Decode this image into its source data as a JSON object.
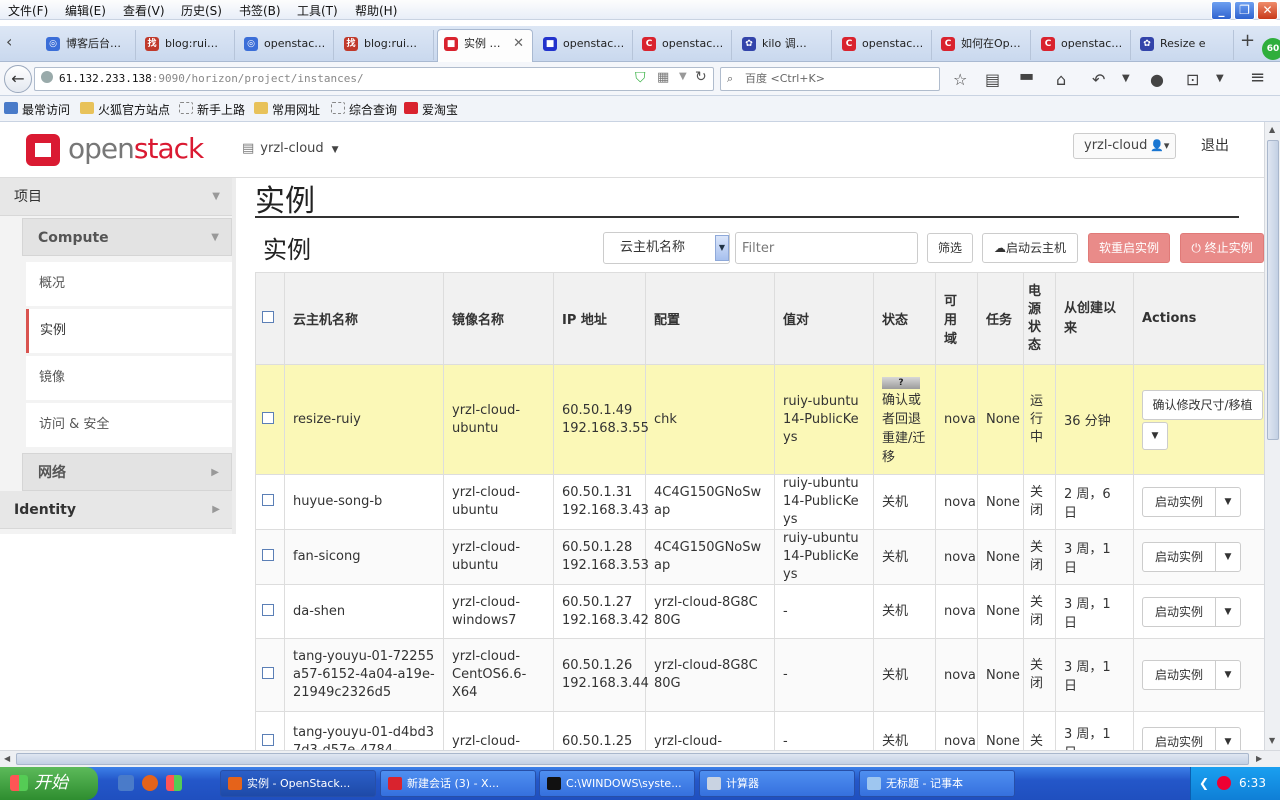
{
  "browser": {
    "menu": [
      "文件(F)",
      "编辑(E)",
      "查看(V)",
      "历史(S)",
      "书签(B)",
      "工具(T)",
      "帮助(H)"
    ],
    "tabs": [
      {
        "label": "博客后台…",
        "color": "#3b6ed8",
        "glyph": "◎"
      },
      {
        "label": "blog:rui…",
        "color": "#c0392b",
        "glyph": "找"
      },
      {
        "label": "openstac…",
        "color": "#3b6ed8",
        "glyph": "◎"
      },
      {
        "label": "blog:rui…",
        "color": "#c0392b",
        "glyph": "找"
      },
      {
        "label": "实例 …",
        "color": "#d9232e",
        "glyph": "■"
      },
      {
        "label": "openstac…",
        "color": "#2233cc",
        "glyph": "■"
      },
      {
        "label": "openstac…",
        "color": "#d9232e",
        "glyph": "C"
      },
      {
        "label": "kilo 调…",
        "color": "#3344aa",
        "glyph": "✿"
      },
      {
        "label": "openstac…",
        "color": "#d9232e",
        "glyph": "C"
      },
      {
        "label": "如何在Op…",
        "color": "#d9232e",
        "glyph": "C"
      },
      {
        "label": "openstac…",
        "color": "#d9232e",
        "glyph": "C"
      },
      {
        "label": "Resize e",
        "color": "#3344aa",
        "glyph": "✿"
      }
    ],
    "url_host": "61.132.233.138",
    "url_rest": ":9090/horizon/project/instances/",
    "search_placeholder": "百度 <Ctrl+K>",
    "bookmarks": [
      "最常访问",
      "火狐官方站点",
      "新手上路",
      "常用网址",
      "综合查询",
      "爱淘宝"
    ],
    "badge": "60"
  },
  "header": {
    "logo_open": "open",
    "logo_stack": "stack",
    "project": "yrzl-cloud",
    "user": "yrzl-cloud",
    "logout": "退出"
  },
  "sidebar": {
    "project": "项目",
    "compute": "Compute",
    "items": [
      "概况",
      "实例",
      "镜像",
      "访问 & 安全"
    ],
    "network": "网络",
    "identity": "Identity"
  },
  "main": {
    "title": "实例",
    "panel_title": "实例",
    "filter_select": "云主机名称",
    "filter_placeholder": "Filter",
    "filter_button": "筛选",
    "launch_button": "启动云主机",
    "soft_reboot_button": "软重启实例",
    "terminate_button": "终止实例"
  },
  "table": {
    "headers": [
      "云主机名称",
      "镜像名称",
      "IP 地址",
      "配置",
      "值对",
      "状态",
      "可用域",
      "任务",
      "电源状态",
      "从创建以来",
      "Actions"
    ],
    "rows": [
      {
        "name": "resize-ruiy",
        "image": "yrzl-cloud-ubuntu",
        "ip1": "60.50.1.49",
        "ip2": "192.168.3.55",
        "flavor": "chk",
        "keypair": "ruiy-ubuntu14-PublicKeys",
        "status": "确认或者回退重建/迁移",
        "status_badge": "?",
        "zone": "nova",
        "task": "None",
        "power": "运行中",
        "age": "36 分钟",
        "action": "确认修改尺寸/移植"
      },
      {
        "name": "huyue-song-b",
        "image": "yrzl-cloud-ubuntu",
        "ip1": "60.50.1.31",
        "ip2": "192.168.3.43",
        "flavor": "4C4G150GNoSwap",
        "keypair": "ruiy-ubuntu14-PublicKeys",
        "status": "关机",
        "zone": "nova",
        "task": "None",
        "power": "关闭",
        "age": "2 周，6 日",
        "action": "启动实例"
      },
      {
        "name": "fan-sicong",
        "image": "yrzl-cloud-ubuntu",
        "ip1": "60.50.1.28",
        "ip2": "192.168.3.53",
        "flavor": "4C4G150GNoSwap",
        "keypair": "ruiy-ubuntu14-PublicKeys",
        "status": "关机",
        "zone": "nova",
        "task": "None",
        "power": "关闭",
        "age": "3 周，1 日",
        "action": "启动实例"
      },
      {
        "name": "da-shen",
        "image": "yrzl-cloud-windows7",
        "ip1": "60.50.1.27",
        "ip2": "192.168.3.42",
        "flavor": "yrzl-cloud-8G8C80G",
        "keypair": "-",
        "status": "关机",
        "zone": "nova",
        "task": "None",
        "power": "关闭",
        "age": "3 周，1 日",
        "action": "启动实例"
      },
      {
        "name": "tang-youyu-01-72255a57-6152-4a04-a19e-21949c2326d5",
        "image": "yrzl-cloud-CentOS6.6-X64",
        "ip1": "60.50.1.26",
        "ip2": "192.168.3.44",
        "flavor": "yrzl-cloud-8G8C80G",
        "keypair": "-",
        "status": "关机",
        "zone": "nova",
        "task": "None",
        "power": "关闭",
        "age": "3 周，1 日",
        "action": "启动实例"
      },
      {
        "name": "tang-youyu-01-d4bd37d3-d57e-4784-",
        "image": "yrzl-cloud-",
        "ip1": "60.50.1.25",
        "ip2": "",
        "flavor": "yrzl-cloud-",
        "keypair": "-",
        "status": "关机",
        "zone": "nova",
        "task": "None",
        "power": "关",
        "age": "3 周，1 日",
        "action": "启动实例"
      }
    ]
  },
  "taskbar": {
    "start": "开始",
    "tasks": [
      {
        "label": "实例 - OpenStack...",
        "color": "#e5631a"
      },
      {
        "label": "新建会话 (3) - X...",
        "color": "#d9232e"
      },
      {
        "label": "C:\\WINDOWS\\syste...",
        "color": "#111111"
      },
      {
        "label": "计算器",
        "color": "#c9d3e2"
      },
      {
        "label": "无标题 - 记事本",
        "color": "#9ec6f0"
      }
    ],
    "clock": "6:33"
  }
}
